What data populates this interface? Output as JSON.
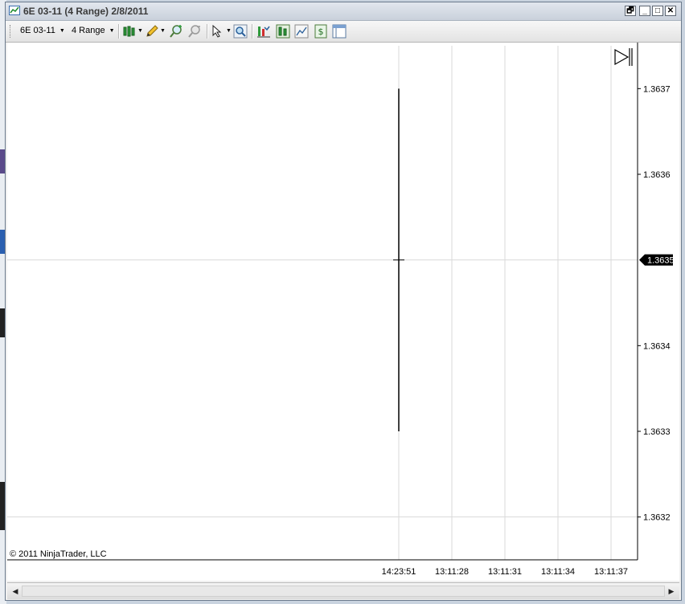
{
  "window": {
    "title": "6E 03-11 (4 Range)  2/8/2011",
    "icon": "chart-icon",
    "controls": {
      "restore_label": "🗗",
      "minimize_label": "_",
      "maximize_label": "□",
      "close_label": "✕"
    }
  },
  "toolbar": {
    "instrument": "6E 03-11",
    "interval": "4 Range",
    "icons": [
      "bar-style-icon",
      "draw-pencil-icon",
      "zoom-in-icon",
      "zoom-out-icon",
      "cursor-pointer-icon",
      "magnifier-icon",
      "indicators-icon",
      "strategies-icon",
      "chart-properties-icon",
      "data-box-icon",
      "chart-template-icon"
    ]
  },
  "chart_data": {
    "type": "range-bar",
    "instrument": "6E 03-11",
    "interval": "4 Range",
    "y_axis": {
      "ticks": [
        "1.3637",
        "1.3636",
        "1.3635",
        "1.3634",
        "1.3633",
        "1.3632"
      ],
      "ylim": [
        1.36315,
        1.36375
      ]
    },
    "x_axis": {
      "ticks": [
        "14:23:51",
        "13:11:28",
        "13:11:31",
        "13:11:34",
        "13:11:37"
      ]
    },
    "bars": [
      {
        "time": "14:23:51",
        "high": 1.3637,
        "low": 1.3633,
        "close": 1.3635
      }
    ],
    "last_price": "1.3635",
    "copyright": "© 2011 NinjaTrader, LLC",
    "grid": true,
    "colors": {
      "background": "#ffffff",
      "grid": "#d9d9d9",
      "bar": "#000000",
      "price_marker": "#000000",
      "price_marker_text": "#ffffff"
    }
  },
  "scrollbar": {
    "left_arrow": "◀",
    "right_arrow": "▶"
  }
}
